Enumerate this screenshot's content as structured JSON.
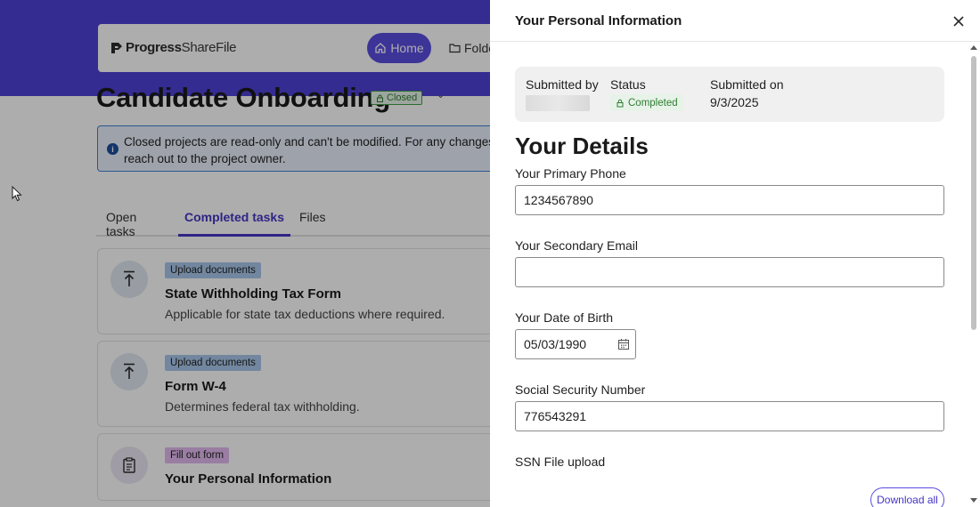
{
  "background": {
    "logo": {
      "brand_bold": "Progress",
      "brand_light": "ShareFile"
    },
    "nav": {
      "home_label": "Home",
      "folders_label": "Folde"
    },
    "project": {
      "title": "Candidate Onboarding",
      "badge": "Closed"
    },
    "alert": {
      "text": "Closed projects are read-only and can't be modified. For any changes, please reach out to the project owner."
    },
    "tabs": [
      {
        "label": "Open tasks"
      },
      {
        "label": "Completed tasks"
      },
      {
        "label": "Files"
      }
    ],
    "tasks": [
      {
        "tag": "Upload documents",
        "title": "State Withholding Tax Form",
        "description": "Applicable for state tax deductions where required."
      },
      {
        "tag": "Upload documents",
        "title": "Form W-4",
        "description": "Determines federal tax withholding."
      },
      {
        "tag": "Fill out form",
        "title": "Your Personal Information",
        "description": ""
      }
    ]
  },
  "drawer": {
    "title": "Your Personal Information",
    "summary": {
      "submitted_by_label": "Submitted by",
      "status_label": "Status",
      "status_value": "Completed",
      "submitted_on_label": "Submitted on",
      "submitted_on_value": "9/3/2025"
    },
    "section_heading": "Your Details",
    "fields": {
      "primary_phone": {
        "label": "Your Primary Phone",
        "value": "1234567890"
      },
      "secondary_email": {
        "label": "Your Secondary Email",
        "value": ""
      },
      "dob": {
        "label": "Your Date of Birth",
        "value": "05/03/1990"
      },
      "ssn": {
        "label": "Social Security Number",
        "value": "776543291"
      },
      "ssn_upload": {
        "label": "SSN File upload"
      }
    },
    "download_all_label": "Download all"
  },
  "colors": {
    "brand_purple": "#4e41d6",
    "accent_purple": "#4535c4",
    "status_green": "#2e7d32"
  }
}
